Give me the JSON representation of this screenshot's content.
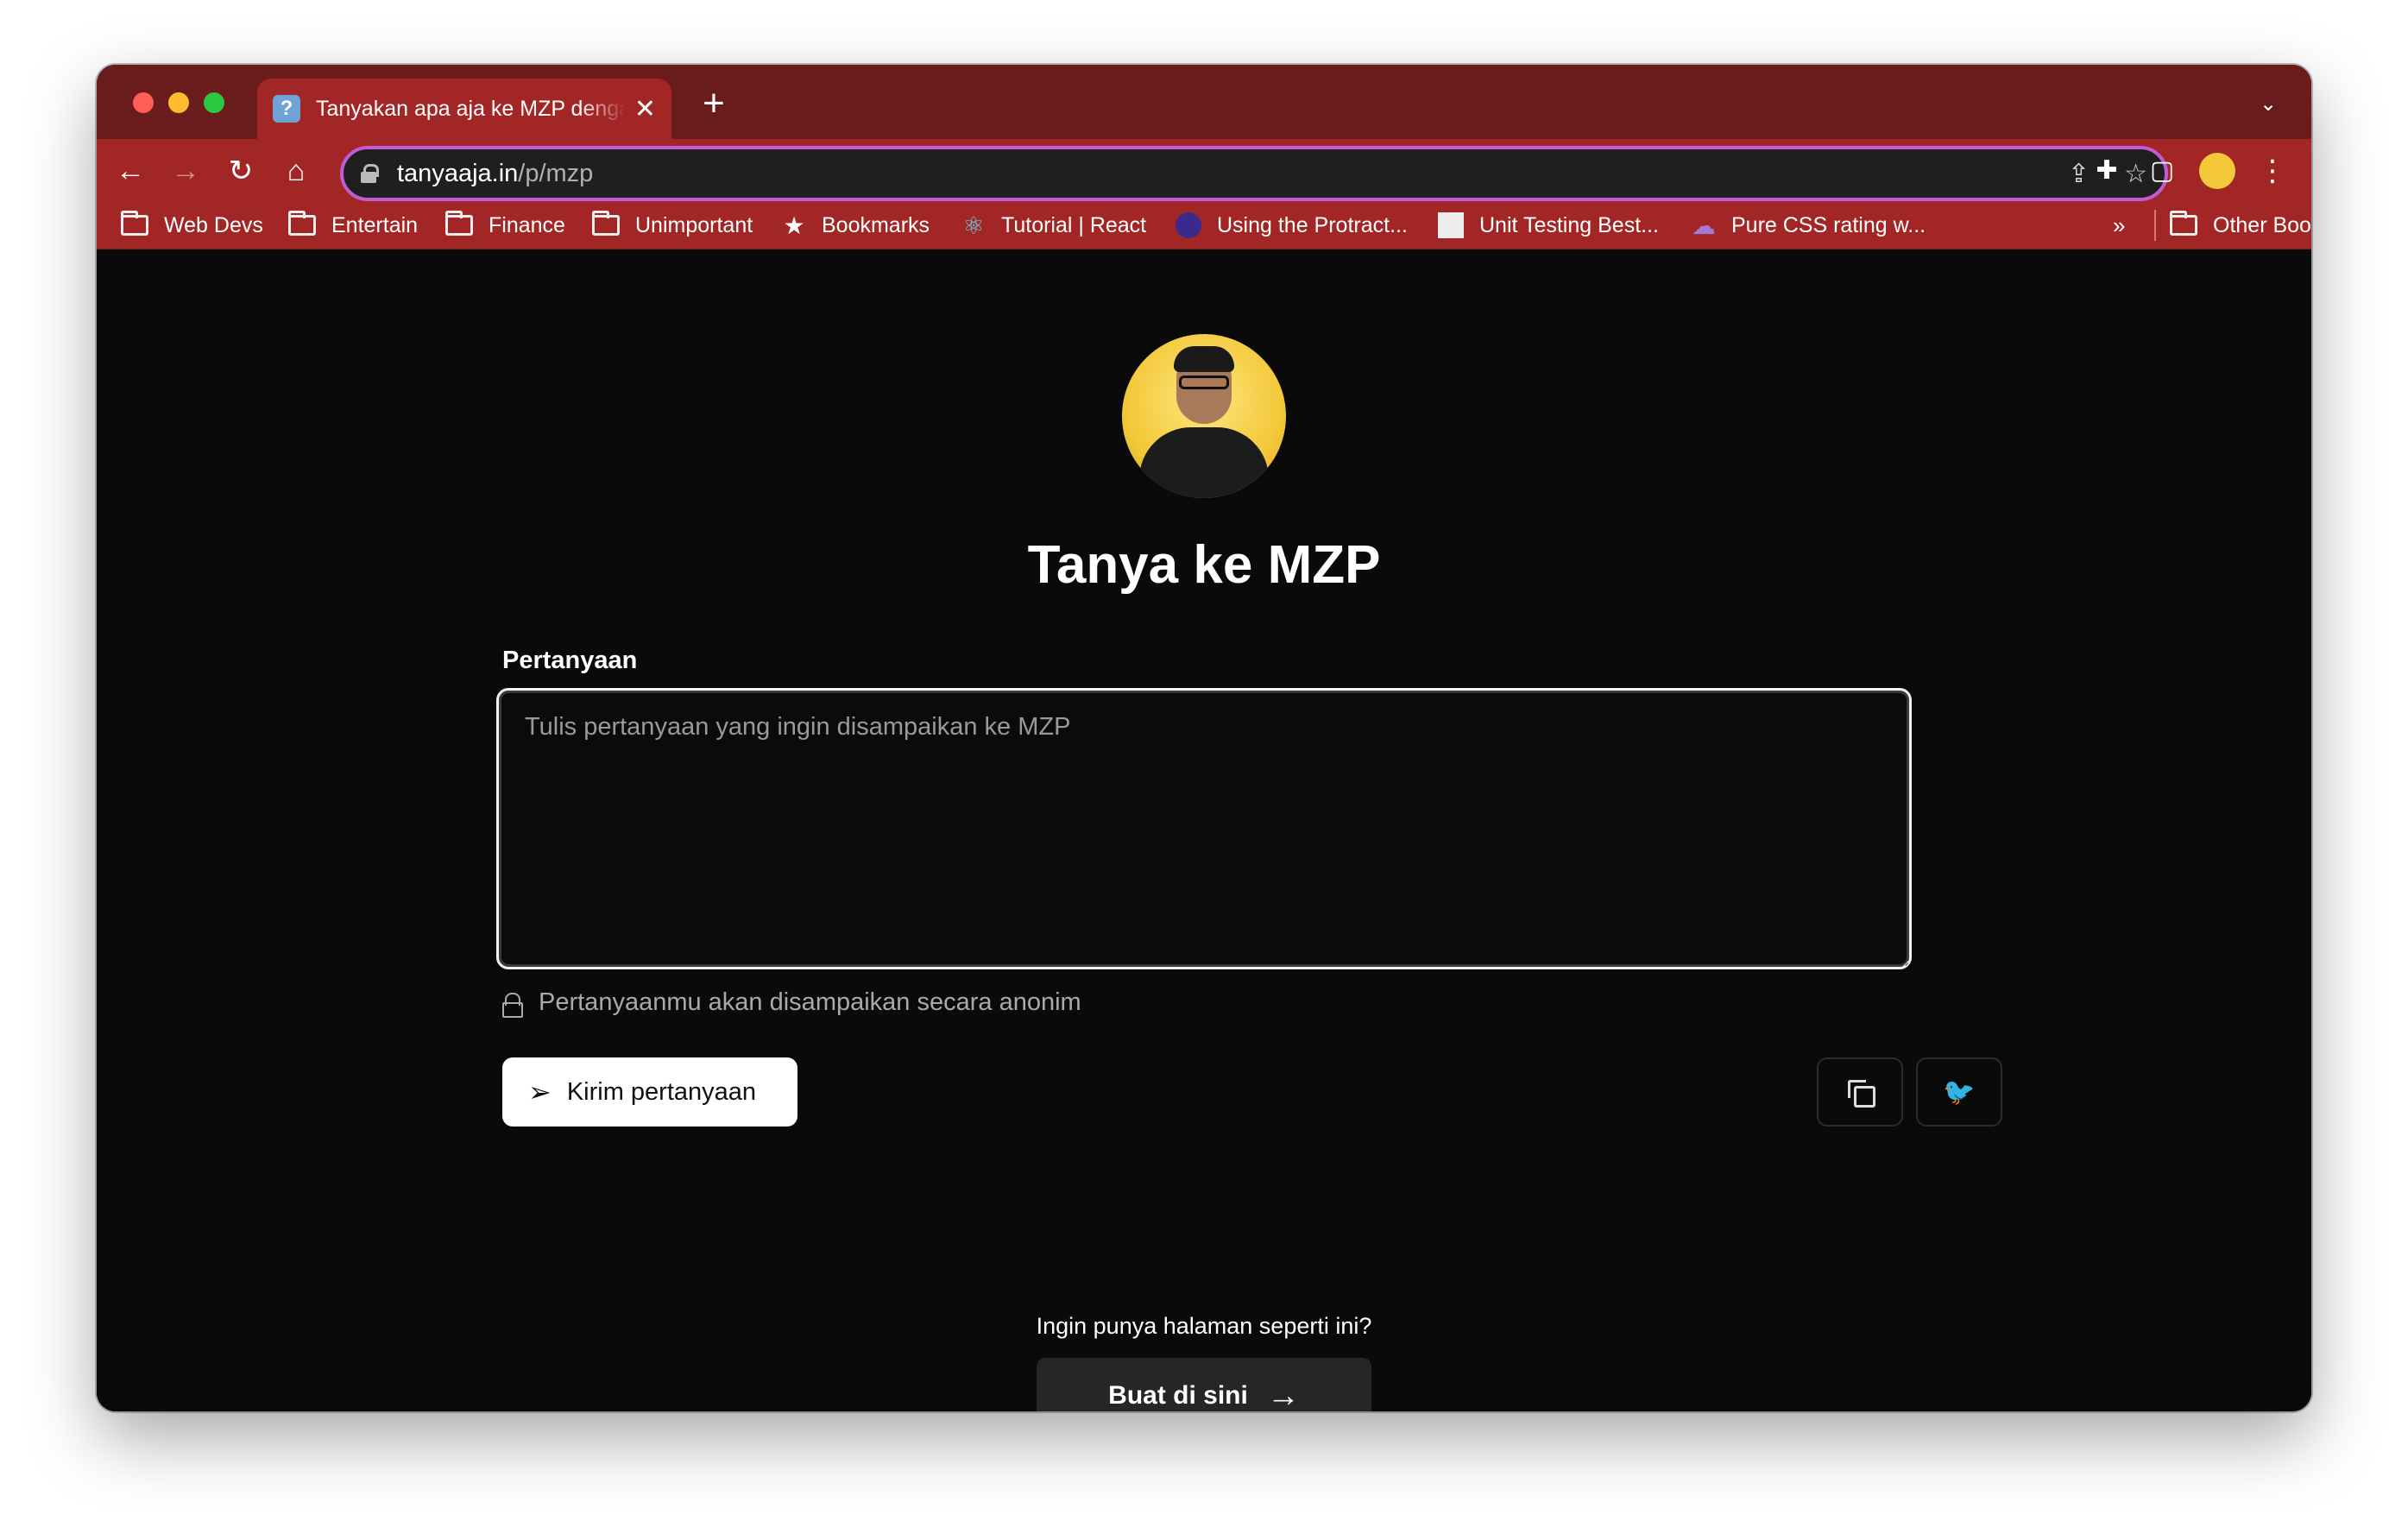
{
  "browser": {
    "tab": {
      "favicon": "?",
      "title": "Tanyakan apa aja ke MZP dengan anonim",
      "close": "✕"
    },
    "new_tab": "+",
    "tab_menu": "⌄",
    "nav": {
      "back": "←",
      "forward": "→",
      "reload": "↻",
      "home": "⌂"
    },
    "url": {
      "host": "tanyaaja.in",
      "path": "/p/mzp"
    },
    "omni_icons": {
      "share": "⇪",
      "star": "☆"
    },
    "toolbar_icons": {
      "extensions": "✚",
      "sidebar": "▢",
      "menu": "⋮"
    },
    "bookmarks": [
      {
        "label": "Web Devs",
        "icon": "folder-icon"
      },
      {
        "label": "Entertain",
        "icon": "folder-icon"
      },
      {
        "label": "Finance",
        "icon": "folder-icon"
      },
      {
        "label": "Unimportant",
        "icon": "folder-icon"
      },
      {
        "label": "Bookmarks",
        "icon": "star-icon",
        "glyph": "★"
      },
      {
        "label": "Tutorial | React",
        "icon": "react-icon",
        "glyph": "⚛"
      },
      {
        "label": "Using the Protract...",
        "icon": "protractor-icon"
      },
      {
        "label": "Unit Testing Best...",
        "icon": "unit-testing-icon"
      },
      {
        "label": "Pure CSS rating w...",
        "icon": "cloud-icon",
        "glyph": "☁"
      }
    ],
    "bookmarks_overflow": "»",
    "other_bookmarks": "Other Bookmarks",
    "accent_color": "#a32626",
    "omnibox_focus_color": "#c35bd4"
  },
  "page": {
    "title": "Tanya ke MZP",
    "question_label": "Pertanyaan",
    "question_placeholder": "Tulis pertanyaan yang ingin disampaikan ke MZP",
    "question_value": "",
    "anon_note": "Pertanyaanmu akan disampaikan secara anonim",
    "send_label": "Kirim pertanyaan",
    "send_icon": "➢",
    "twitter_icon": "🐦",
    "cta_question": "Ingin punya halaman seperti ini?",
    "cta_button": "Buat di sini",
    "cta_arrow": "→"
  }
}
